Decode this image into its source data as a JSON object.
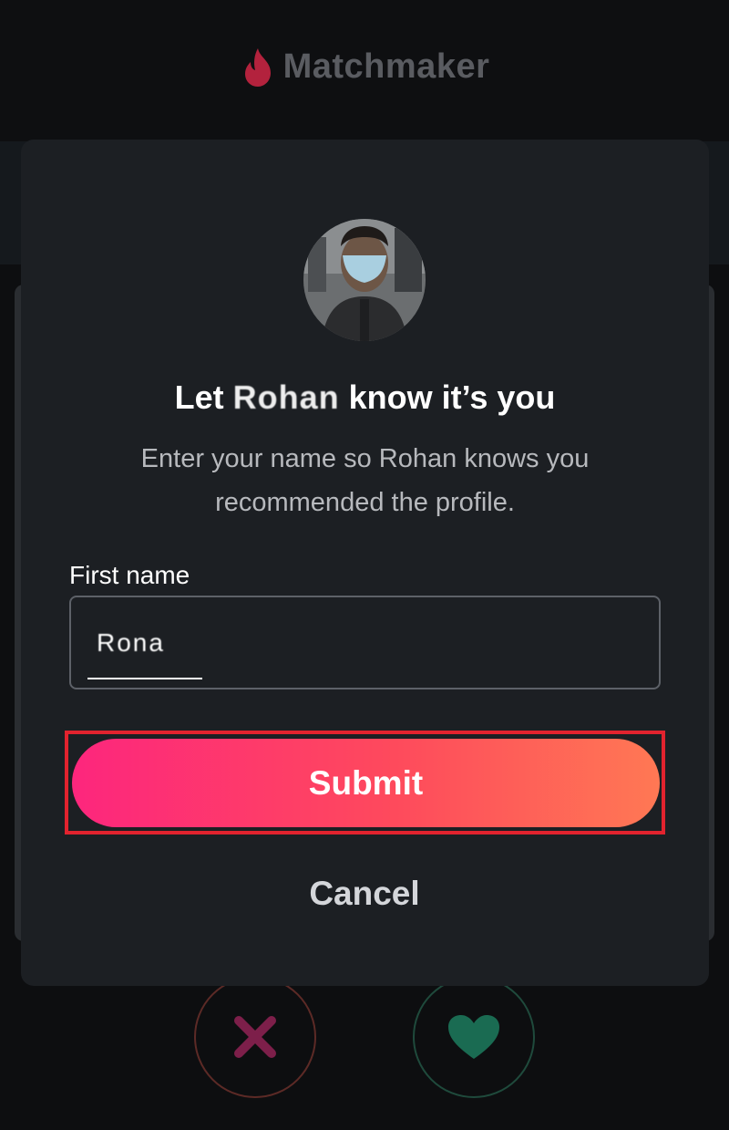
{
  "app": {
    "brand_name": "Matchmaker",
    "brand_icon": "flame-icon",
    "brand_color": "#fd3a5b"
  },
  "modal": {
    "avatar_icon": "profile-photo",
    "heading_prefix": "Let ",
    "heading_name": "Rohan",
    "heading_suffix": " know it’s you",
    "subtext": "Enter your name so Rohan knows you recommended the profile.",
    "field_label": "First name",
    "field_value": "Rona",
    "submit_label": "Submit",
    "cancel_label": "Cancel",
    "submit_gradient": [
      "#fd267d",
      "#ff7854"
    ],
    "highlight_color": "#e2232e"
  },
  "actions": {
    "nope_icon": "x-icon",
    "nope_color": "#c2185b",
    "like_icon": "heart-icon",
    "like_color": "#1f8f6a"
  }
}
